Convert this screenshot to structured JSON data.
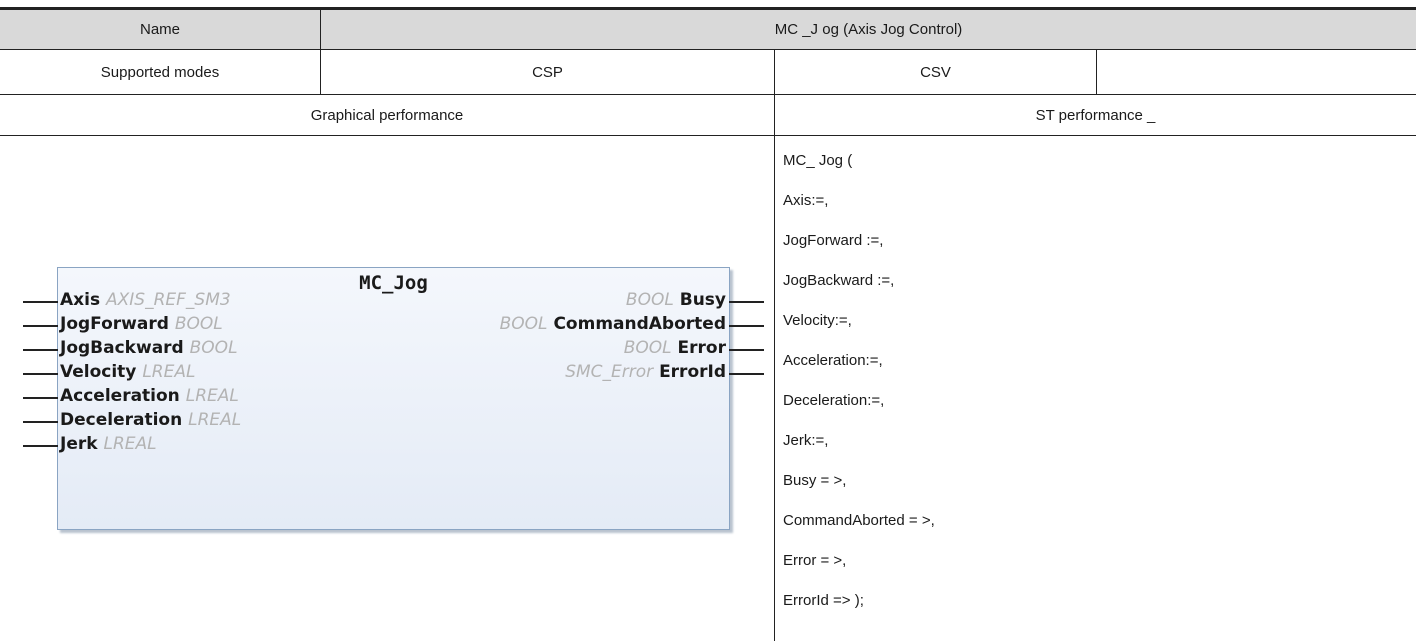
{
  "table": {
    "row1": {
      "name_label": "Name",
      "name_value": "MC _J og (Axis Jog Control)"
    },
    "row2": {
      "modes_label": "Supported modes",
      "mode_csp": "CSP",
      "mode_csv": "CSV",
      "mode_extra": ""
    },
    "row3": {
      "graphical": "Graphical performance",
      "st": "ST performance _"
    },
    "header_bg": "#d9d9d9"
  },
  "function_block": {
    "title": "MC_Jog",
    "inputs": [
      {
        "name": "Axis",
        "type": "AXIS_REF_SM3"
      },
      {
        "name": "JogForward",
        "type": "BOOL"
      },
      {
        "name": "JogBackward",
        "type": "BOOL"
      },
      {
        "name": "Velocity",
        "type": "LREAL"
      },
      {
        "name": "Acceleration",
        "type": "LREAL"
      },
      {
        "name": "Deceleration",
        "type": "LREAL"
      },
      {
        "name": "Jerk",
        "type": "LREAL"
      }
    ],
    "outputs": [
      {
        "name": "Busy",
        "type": "BOOL"
      },
      {
        "name": "CommandAborted",
        "type": "BOOL"
      },
      {
        "name": "Error",
        "type": "BOOL"
      },
      {
        "name": "ErrorId",
        "type": "SMC_Error"
      }
    ]
  },
  "st_code": [
    "MC_ Jog (",
    "Axis:=,",
    "JogForward :=,",
    "JogBackward :=,",
    "Velocity:=,",
    "Acceleration:=,",
    "Deceleration:=,",
    "Jerk:=,",
    "Busy = >,",
    "CommandAborted = >,",
    "Error = >,",
    "ErrorId => );"
  ]
}
